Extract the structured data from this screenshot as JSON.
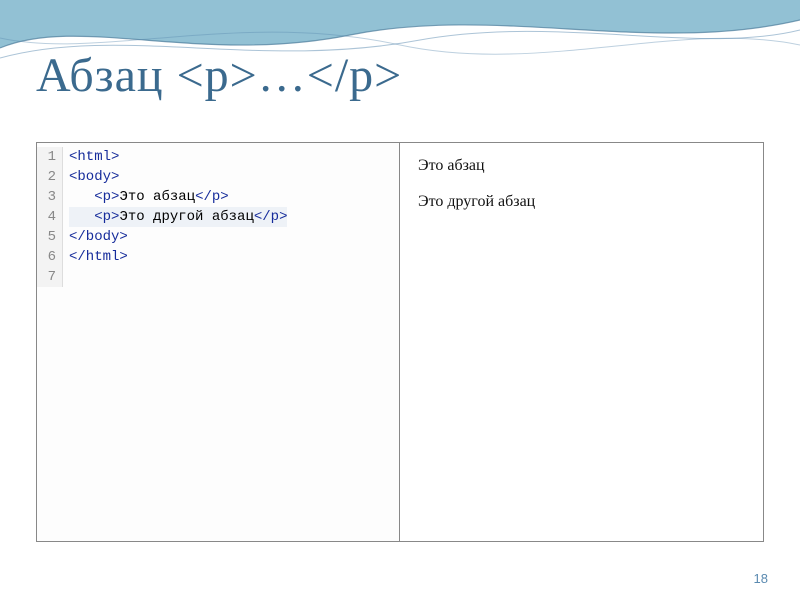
{
  "title": "Абзац  <p>…</p>",
  "page_number": "18",
  "code": {
    "lines": [
      {
        "num": "1",
        "segments": [
          {
            "t": "tag",
            "v": "<html>"
          }
        ],
        "indent": 0
      },
      {
        "num": "2",
        "segments": [
          {
            "t": "tag",
            "v": "<body>"
          }
        ],
        "indent": 0
      },
      {
        "num": "3",
        "segments": [
          {
            "t": "tag",
            "v": "<p>"
          },
          {
            "t": "txt",
            "v": "Это абзац"
          },
          {
            "t": "tag",
            "v": "</p>"
          }
        ],
        "indent": 3
      },
      {
        "num": "4",
        "segments": [
          {
            "t": "tag",
            "v": "<p>"
          },
          {
            "t": "txt",
            "v": "Это другой абзац"
          },
          {
            "t": "tag",
            "v": "</p>"
          }
        ],
        "indent": 3,
        "hl": true
      },
      {
        "num": "5",
        "segments": [
          {
            "t": "tag",
            "v": "</body>"
          }
        ],
        "indent": 0
      },
      {
        "num": "6",
        "segments": [
          {
            "t": "tag",
            "v": "</html>"
          }
        ],
        "indent": 0
      },
      {
        "num": "7",
        "segments": [],
        "indent": 0
      }
    ]
  },
  "preview": {
    "p1": "Это абзац",
    "p2": "Это другой абзац"
  }
}
